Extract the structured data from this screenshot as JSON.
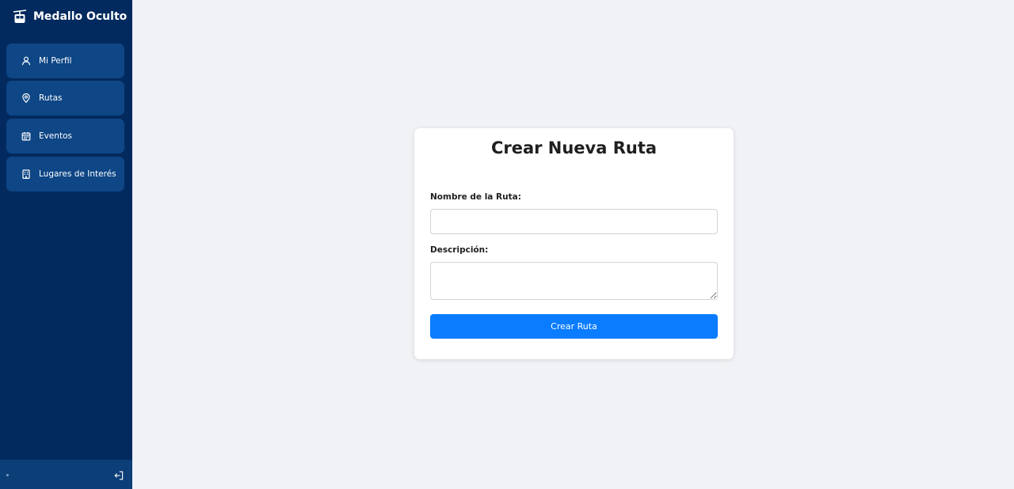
{
  "brand": {
    "title": "Medallo Oculto",
    "icon": "cable-car-icon"
  },
  "sidebar": {
    "items": [
      {
        "label": "Mi Perfil",
        "icon": "user-icon"
      },
      {
        "label": "Rutas",
        "icon": "map-pin-icon"
      },
      {
        "label": "Eventos",
        "icon": "calendar-icon"
      },
      {
        "label": "Lugares de Interés",
        "icon": "building-icon"
      }
    ],
    "footer": {
      "icon": "logout-icon"
    }
  },
  "form": {
    "title": "Crear Nueva Ruta",
    "name_label": "Nombre de la Ruta:",
    "name_value": "",
    "description_label": "Descripción:",
    "description_value": "",
    "submit_label": "Crear Ruta"
  },
  "colors": {
    "sidebar_bg": "#032a5e",
    "nav_item_bg": "#0e4686",
    "footer_bg": "#0c3f78",
    "page_bg": "#f0f2f5",
    "accent": "#0a7cff"
  }
}
